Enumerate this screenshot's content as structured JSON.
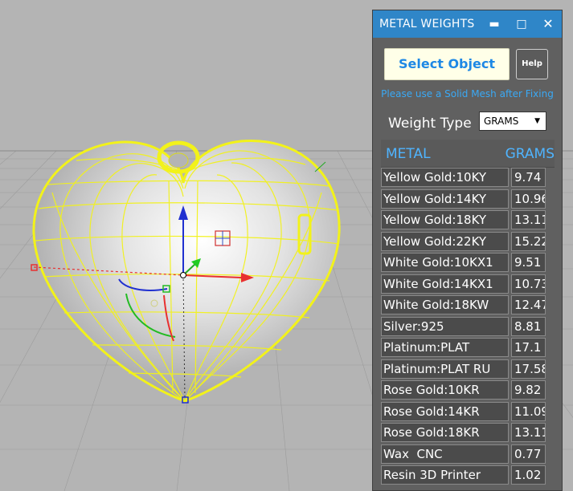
{
  "panel": {
    "title": "METAL WEIGHTS",
    "minimize_icon": "minimize-icon",
    "maximize_icon": "maximize-icon",
    "close_icon": "close-icon",
    "select_object_label": "Select Object",
    "help_label": "Help",
    "hint": "Please use a Solid Mesh after Fixing",
    "weight_type_label": "Weight Type",
    "weight_type_value": "GRAMS",
    "header_metal": "METAL",
    "header_grams": "GRAMS",
    "accent_color": "#2f86c8",
    "rows": [
      {
        "metal": "Yellow Gold:10KY",
        "grams": "9.74"
      },
      {
        "metal": "Yellow Gold:14KY",
        "grams": "10.96"
      },
      {
        "metal": "Yellow Gold:18KY",
        "grams": "13.11"
      },
      {
        "metal": "Yellow Gold:22KY",
        "grams": "15.22"
      },
      {
        "metal": "White Gold:10KX1",
        "grams": "9.51"
      },
      {
        "metal": "White Gold:14KX1",
        "grams": "10.73"
      },
      {
        "metal": "White Gold:18KW",
        "grams": "12.47"
      },
      {
        "metal": "Silver:925",
        "grams": "8.81"
      },
      {
        "metal": "Platinum:PLAT",
        "grams": "17.1"
      },
      {
        "metal": "Platinum:PLAT RU",
        "grams": "17.58"
      },
      {
        "metal": "Rose Gold:10KR",
        "grams": "9.82"
      },
      {
        "metal": "Rose Gold:14KR",
        "grams": "11.09"
      },
      {
        "metal": "Rose Gold:18KR",
        "grams": "13.11"
      },
      {
        "metal": "Wax  CNC",
        "grams": "0.77"
      },
      {
        "metal": "Resin 3D Printer",
        "grams": "1.02"
      }
    ]
  },
  "viewport": {
    "background_color": "#b5b5b5",
    "wireframe_color": "#f2f21a"
  }
}
